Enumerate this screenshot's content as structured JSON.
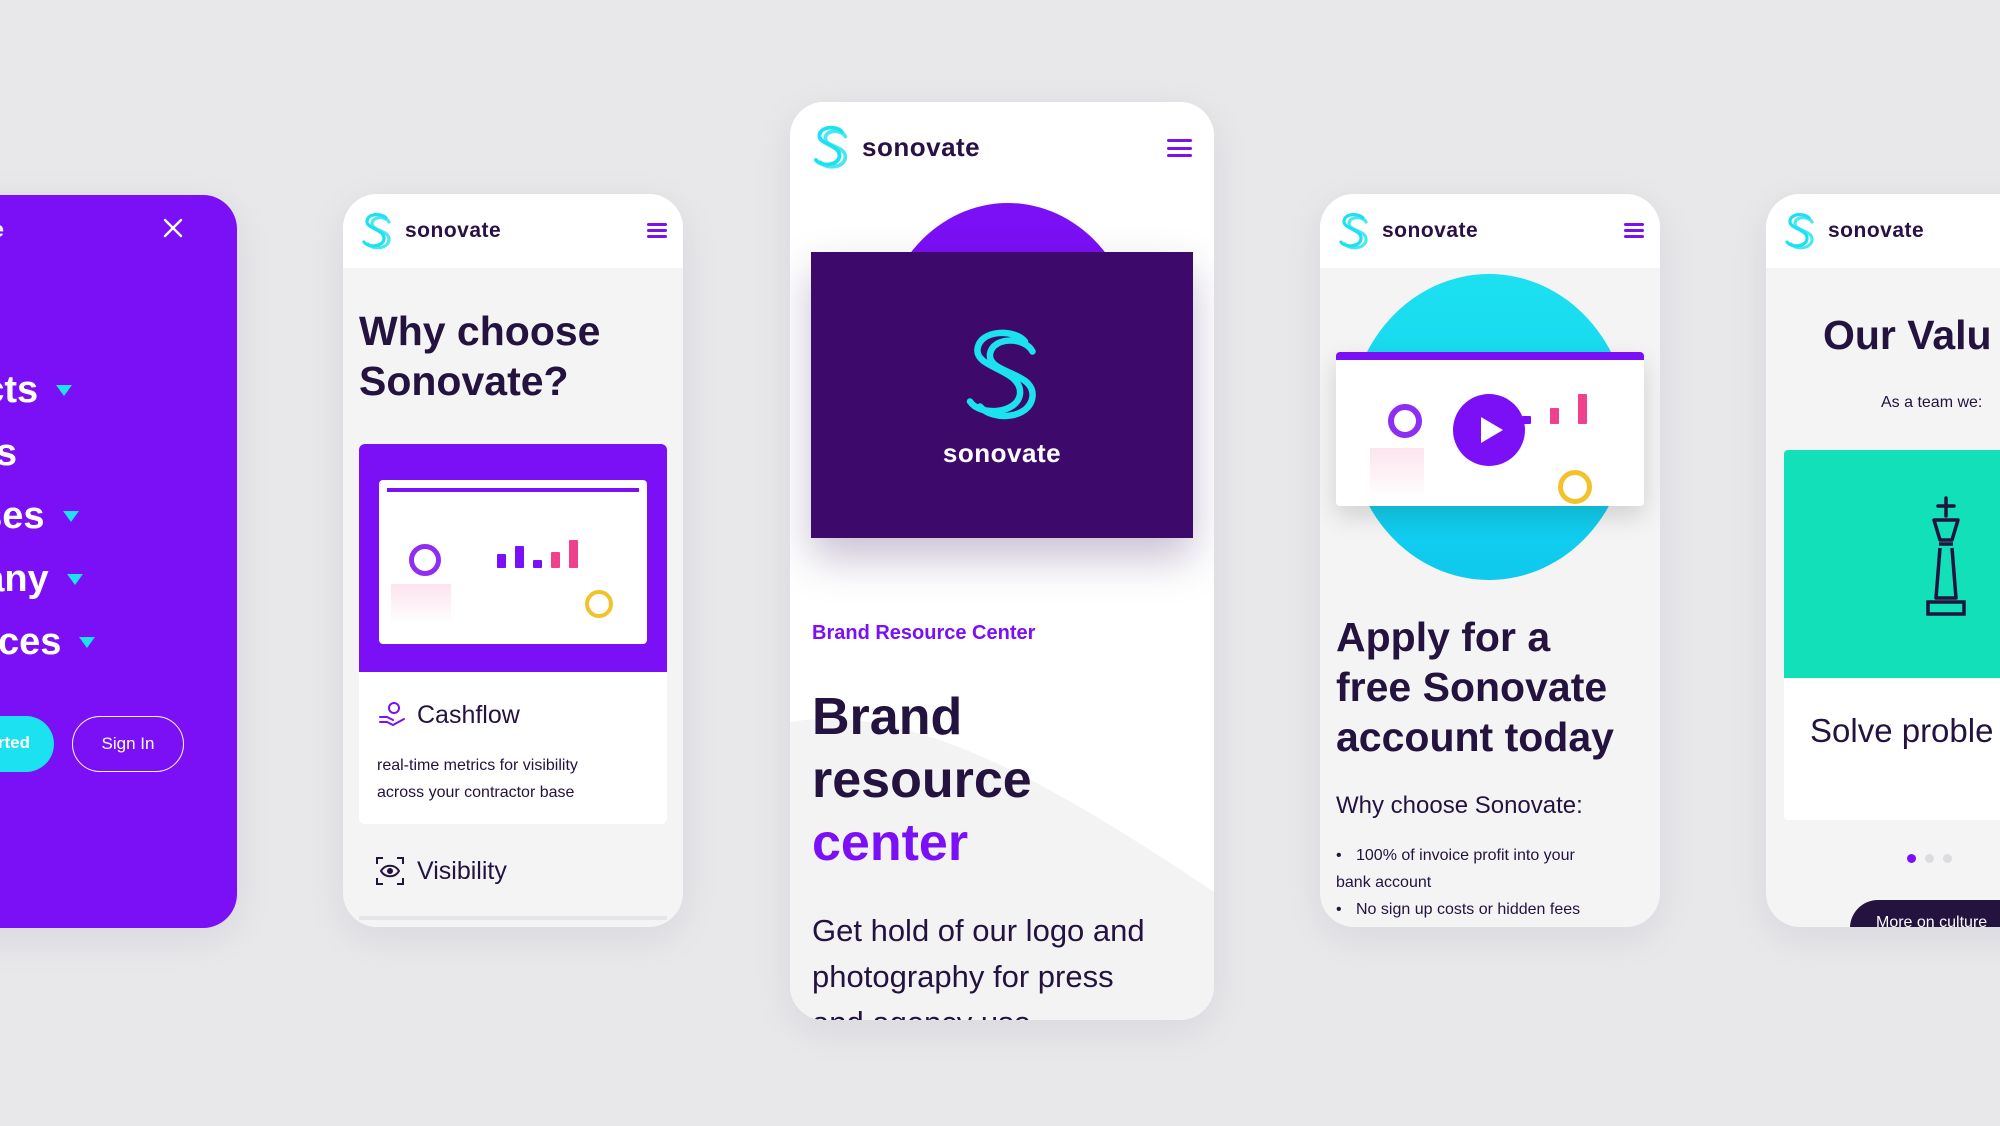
{
  "brand": {
    "name": "sonovate",
    "colors": {
      "purple": "#7b0ff5",
      "dark": "#3d0a6b",
      "cyan": "#1ce1f0",
      "teal": "#12e0b9",
      "ink": "#24123f"
    }
  },
  "menu_screen": {
    "logo_fragment": "vate",
    "items": [
      {
        "label": "e"
      },
      {
        "label": "ucts"
      },
      {
        "label": "fits"
      },
      {
        "label": "ases"
      },
      {
        "label": "pany"
      },
      {
        "label": "urces"
      }
    ],
    "get_started_fragment": "rted",
    "sign_in": "Sign In",
    "icons": {
      "close": "close-icon",
      "caret": "caret-down-icon"
    }
  },
  "why_screen": {
    "logo": "sonovate",
    "heading_line1": "Why choose",
    "heading_line2": "Sonovate?",
    "feature1": {
      "title": "Cashflow",
      "desc_line1": "real-time metrics for visibility",
      "desc_line2": "across your contractor base",
      "icon": "hand-coin-icon"
    },
    "feature2": {
      "title": "Visibility",
      "icon": "eye-scan-icon"
    }
  },
  "brand_screen": {
    "logo": "sonovate",
    "card_logo": "sonovate",
    "eyebrow": "Brand Resource Center",
    "heading_line1": "Brand",
    "heading_line2": "resource",
    "heading_line3": "center",
    "body_line1": "Get hold of our logo and",
    "body_line2": "photography for press",
    "body_line3": "and agency use"
  },
  "apply_screen": {
    "logo": "sonovate",
    "heading_line1": "Apply for a",
    "heading_line2": "free Sonovate",
    "heading_line3": "account today",
    "subheading": "Why choose Sonovate:",
    "bullet1_line1": "100% of invoice profit into your",
    "bullet1_line2": "bank account",
    "bullet2": "No sign up costs or hidden fees",
    "icons": {
      "play": "play-icon"
    }
  },
  "values_screen": {
    "logo": "sonovate",
    "heading": "Our Valu",
    "subheading": "As a team we:",
    "card_title": "Solve proble",
    "cta_fragment": "More on culture",
    "carousel_active": 1,
    "icons": {
      "chess": "chess-king-icon"
    }
  }
}
